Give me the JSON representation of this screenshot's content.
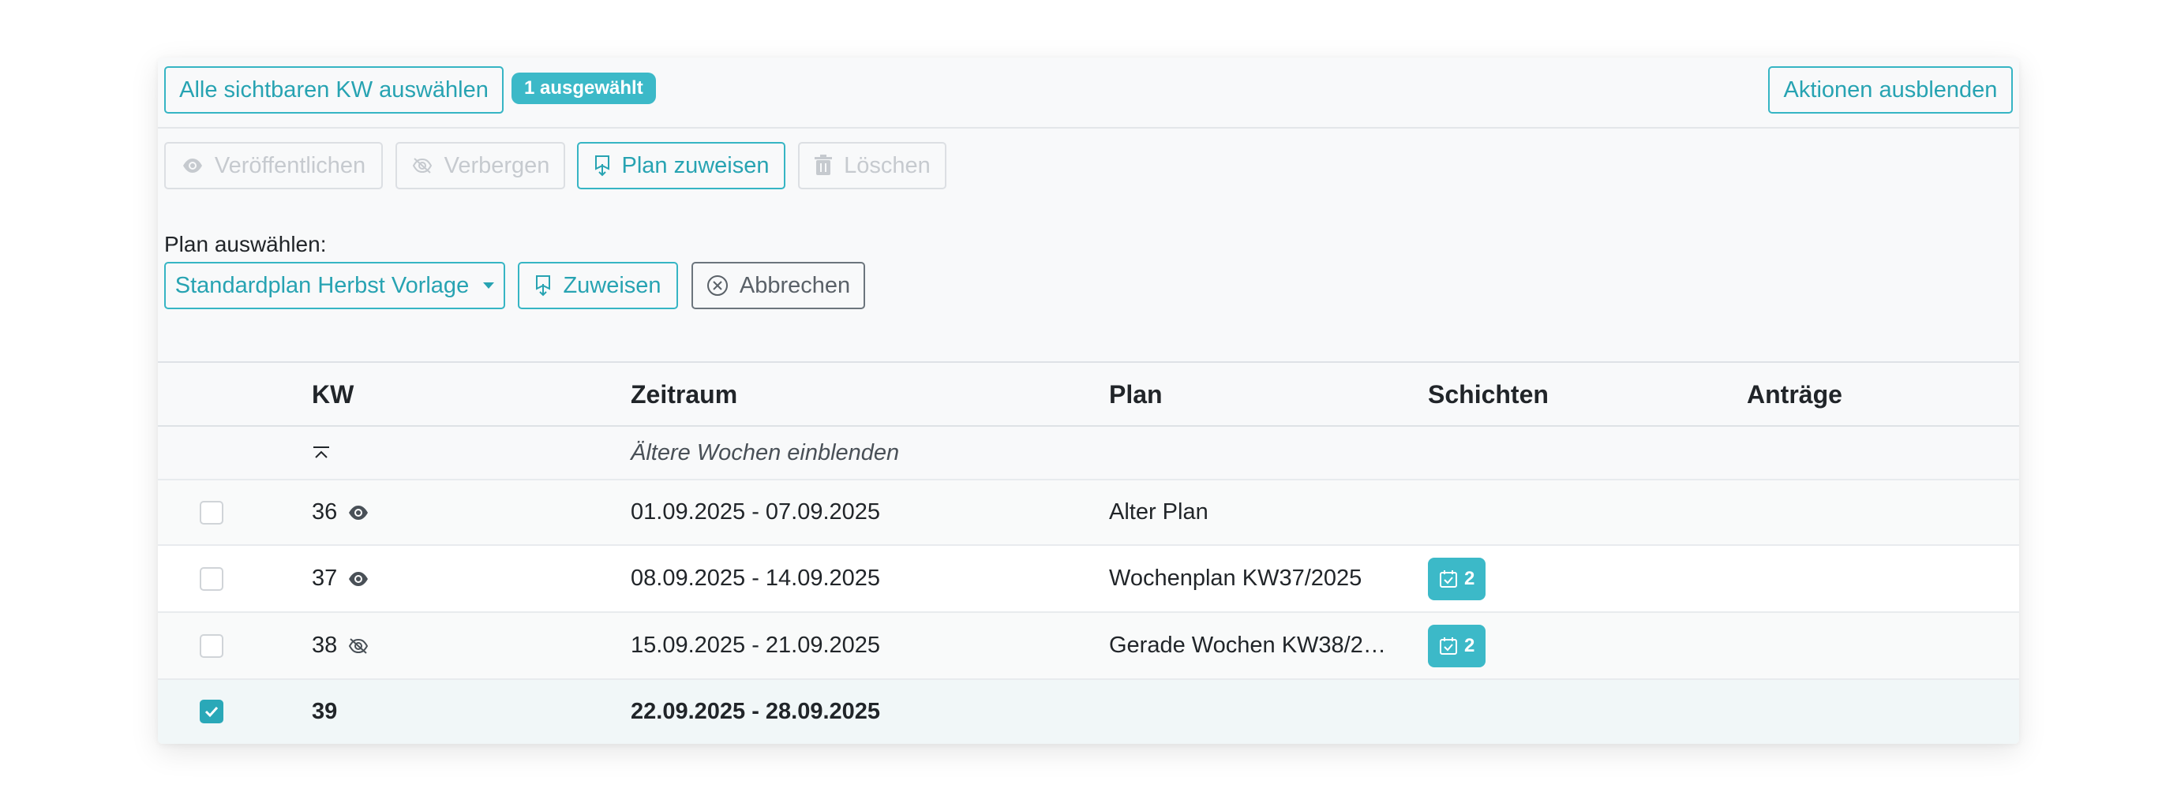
{
  "toolbar": {
    "select_all_label": "Alle sichtbaren KW auswählen",
    "selected_badge": "1 ausgewählt",
    "hide_actions_label": "Aktionen ausblenden"
  },
  "actions": {
    "publish_label": "Veröffentlichen",
    "hide_label": "Verbergen",
    "assign_plan_label": "Plan zuweisen",
    "delete_label": "Löschen"
  },
  "plan_select": {
    "label": "Plan auswählen:",
    "selected": "Standardplan Herbst Vorlage",
    "assign_label": "Zuweisen",
    "cancel_label": "Abbrechen"
  },
  "table": {
    "headers": [
      "KW",
      "Zeitraum",
      "Plan",
      "Schichten",
      "Anträge"
    ],
    "older_weeks_label": "Ältere Wochen einblenden",
    "rows": [
      {
        "kw": "36",
        "visibility": "visible",
        "period": "01.09.2025 - 07.09.2025",
        "plan": "Alter Plan",
        "shifts": "",
        "requests": "",
        "checked": false
      },
      {
        "kw": "37",
        "visibility": "visible",
        "period": "08.09.2025 - 14.09.2025",
        "plan": "Wochenplan KW37/2025",
        "shifts": "2",
        "requests": "",
        "checked": false
      },
      {
        "kw": "38",
        "visibility": "hidden",
        "period": "15.09.2025 - 21.09.2025",
        "plan": "Gerade Wochen KW38/2…",
        "shifts": "2",
        "requests": "",
        "checked": false
      },
      {
        "kw": "39",
        "visibility": "",
        "period": "22.09.2025 - 28.09.2025",
        "plan": "",
        "shifts": "",
        "requests": "",
        "checked": true
      }
    ]
  },
  "colors": {
    "accent": "#36b5c4",
    "badge": "#3cb9c8",
    "selected_row": "#f1f7f8",
    "disabled": "#c6cacf"
  },
  "icons": {
    "publish": "eye-icon",
    "hide": "eye-slash-icon",
    "assign": "bookmark-download-icon",
    "delete": "trash-icon",
    "cancel": "x-circle-icon",
    "older": "chevron-bar-up-icon",
    "shifts": "calendar-check-icon"
  }
}
